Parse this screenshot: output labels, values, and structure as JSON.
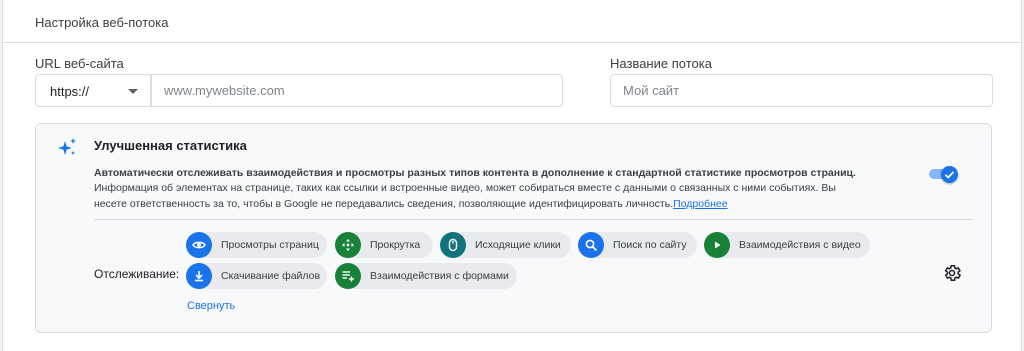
{
  "panel": {
    "title": "Настройка веб-потока"
  },
  "url_field": {
    "label": "URL веб-сайта",
    "protocol_value": "https://",
    "placeholder": "www.mywebsite.com"
  },
  "name_field": {
    "label": "Название потока",
    "placeholder": "Мой сайт"
  },
  "enhanced": {
    "title": "Улучшенная статистика",
    "lead": "Автоматически отслеживать взаимодействия и просмотры разных типов контента в дополнение к стандартной статистике просмотров страниц.",
    "description": "Информация об элементах на странице, таких как ссылки и встроенные видео, может собираться вместе с данными о связанных с ними событиях. Вы несете ответственность за то, чтобы в Google не передавались сведения, позволяющие идентифицировать личность.",
    "learn_more": "Подробнее",
    "toggle_on": true
  },
  "tracking": {
    "label": "Отслеживание:",
    "chips": [
      {
        "label": "Просмотры страниц",
        "icon": "eye-icon",
        "color": "#1a73e8"
      },
      {
        "label": "Прокрутка",
        "icon": "scroll-arrows-icon",
        "color": "#188038"
      },
      {
        "label": "Исходящие клики",
        "icon": "mouse-icon",
        "color": "#12737b"
      },
      {
        "label": "Поиск по сайту",
        "icon": "search-icon",
        "color": "#1a73e8"
      },
      {
        "label": "Взаимодействия с видео",
        "icon": "play-icon",
        "color": "#188038"
      },
      {
        "label": "Скачивание файлов",
        "icon": "download-icon",
        "color": "#1a73e8"
      },
      {
        "label": "Взаимодействия с формами",
        "icon": "form-add-icon",
        "color": "#188038"
      }
    ],
    "collapse": "Свернуть"
  },
  "colors": {
    "accent": "#1a73e8",
    "green": "#188038",
    "teal": "#12737b"
  }
}
